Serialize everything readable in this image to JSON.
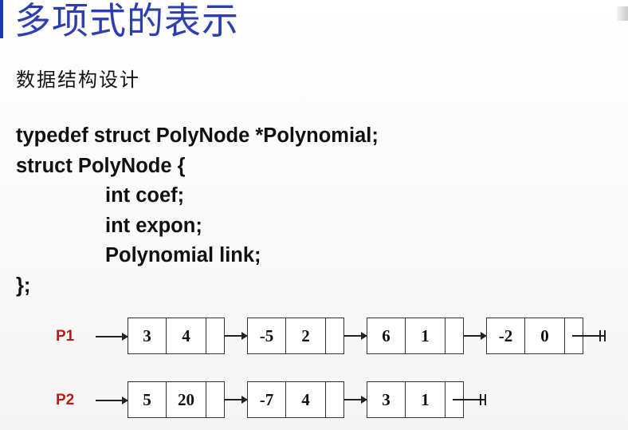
{
  "slide": {
    "title": "多项式的表示",
    "subtitle": "数据结构设计"
  },
  "code": {
    "lines": [
      "typedef struct PolyNode *Polynomial;",
      "struct PolyNode {",
      "int coef;",
      "int expon;",
      "Polynomial link;",
      "};"
    ]
  },
  "lists": [
    {
      "label": "P1",
      "nodes": [
        {
          "coef": "3",
          "expon": "4"
        },
        {
          "coef": "-5",
          "expon": "2"
        },
        {
          "coef": "6",
          "expon": "1"
        },
        {
          "coef": "-2",
          "expon": "0"
        }
      ]
    },
    {
      "label": "P2",
      "nodes": [
        {
          "coef": "5",
          "expon": "20"
        },
        {
          "coef": "-7",
          "expon": "4"
        },
        {
          "coef": "3",
          "expon": "1"
        }
      ]
    }
  ]
}
